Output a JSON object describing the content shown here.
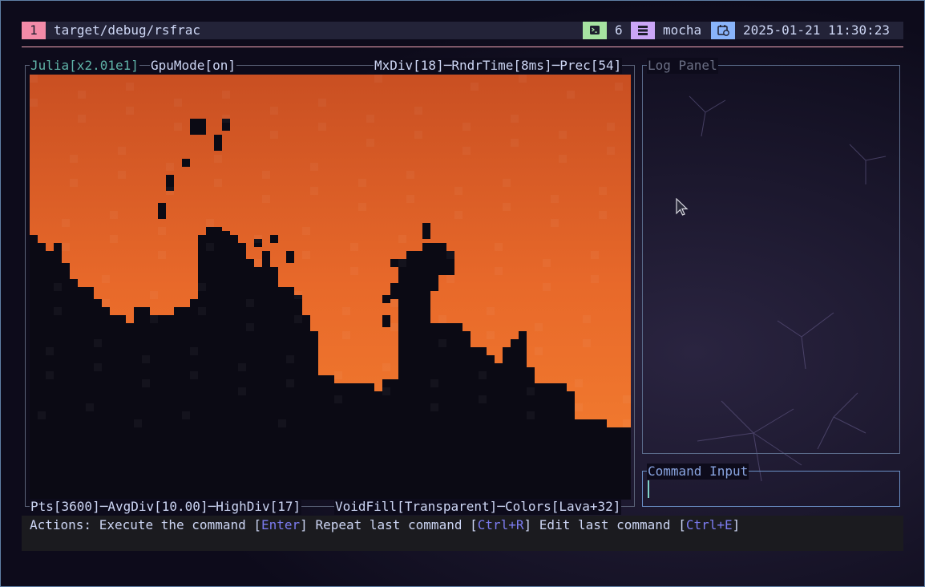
{
  "topbar": {
    "workspace": "1",
    "path": "target/debug/rsfrac",
    "terminal_count": "6",
    "host": "mocha",
    "datetime": "2025-01-21 11:30:23",
    "colors": {
      "workspace": "#f38ba8",
      "terminal": "#a6e3a1",
      "server": "#cba6f7",
      "calendar": "#89b4fa"
    },
    "icons": [
      "terminal-icon",
      "server-icon",
      "calendar-clock-icon"
    ]
  },
  "render_panel": {
    "fractal": "Julia",
    "zoom": "[x2.01e1]",
    "gpu_mode": "GpuMode[on]",
    "max_div": "MxDiv[18]",
    "render_time": "RndrTime[8ms]",
    "precision": "Prec[54]",
    "points": "Pts[3600]",
    "avg_div": "AvgDiv[10.00]",
    "high_div": "HighDiv[17]",
    "void_fill": "VoidFill[Transparent]",
    "colors": "Colors[Lava+32]",
    "palette": {
      "fill": "#e6692b",
      "void": "#0b0a14"
    }
  },
  "log_panel": {
    "title": "Log Panel"
  },
  "command_input": {
    "title": "Command Input",
    "value": ""
  },
  "actions": {
    "prefix": "Actions: ",
    "items": [
      {
        "label": "Execute the command ",
        "key": "Enter"
      },
      {
        "label": "Repeat last command ",
        "key": "Ctrl+R"
      },
      {
        "label": "Edit last command ",
        "key": "Ctrl+E"
      }
    ]
  }
}
